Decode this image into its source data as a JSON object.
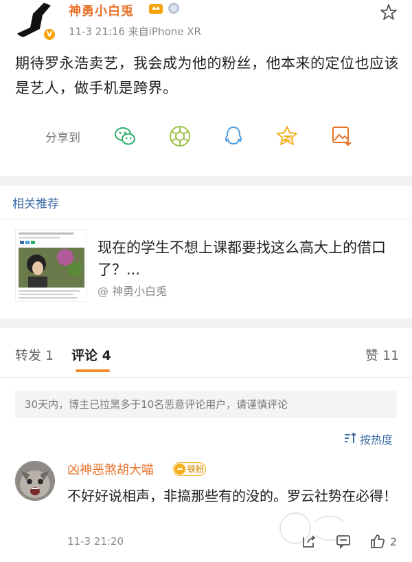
{
  "post": {
    "username": "神勇小白兎",
    "meta": "11-3 21:16  来自iPhone XR",
    "verified_badge": "V",
    "text": "期待罗永浩卖艺，我会成为他的粉丝，他本来的定位也应该是艺人，做手机是跨界。",
    "share_label": "分享到",
    "share_icons": [
      "wechat-icon",
      "moments-icon",
      "qq-icon",
      "qzone-icon",
      "save-image-icon"
    ]
  },
  "related": {
    "title": "相关推荐",
    "item": {
      "title": "现在的学生不想上课都要找这么高大上的借口了？...",
      "author": "@ 神勇小白兎"
    }
  },
  "tabs": {
    "repost": "转发 1",
    "comments": "评论 4",
    "likes": "赞 11"
  },
  "notice": "30天内，博主已拉黑多于10名恶意评论用户，请谨慎评论",
  "sort_label": "按热度",
  "comment": {
    "username": "凶神恶煞胡大喵",
    "badge": "铁粉",
    "text": "不好好说相声，非搞那些有的没的。罗云社势在必得！",
    "meta": "11-3 21:20",
    "like_count": "2"
  },
  "colors": {
    "username": "#e8722a",
    "link": "#3b6ba5",
    "accent": "#f58a2a",
    "share_green": "#2aae67",
    "share_gold": "#f2b01e"
  }
}
